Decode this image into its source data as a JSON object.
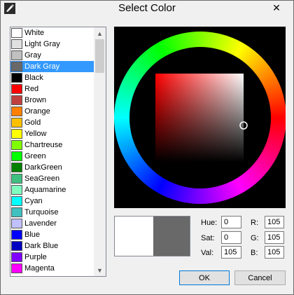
{
  "window": {
    "title": "Select Color",
    "close_glyph": "✕",
    "app_icon": "pencil-icon"
  },
  "color_list": {
    "selected_index": 3,
    "items": [
      {
        "label": "White",
        "color": "#ffffff"
      },
      {
        "label": "Light Gray",
        "color": "#e0e0e0"
      },
      {
        "label": "Gray",
        "color": "#c0c0c0"
      },
      {
        "label": "Dark Gray",
        "color": "#696969"
      },
      {
        "label": "Black",
        "color": "#000000"
      },
      {
        "label": "Red",
        "color": "#ff0000"
      },
      {
        "label": "Brown",
        "color": "#c04040"
      },
      {
        "label": "Orange",
        "color": "#ff8000"
      },
      {
        "label": "Gold",
        "color": "#ffc000"
      },
      {
        "label": "Yellow",
        "color": "#ffff00"
      },
      {
        "label": "Chartreuse",
        "color": "#80ff00"
      },
      {
        "label": "Green",
        "color": "#00ff00"
      },
      {
        "label": "DarkGreen",
        "color": "#008000"
      },
      {
        "label": "SeaGreen",
        "color": "#40c080"
      },
      {
        "label": "Aquamarine",
        "color": "#80ffc0"
      },
      {
        "label": "Cyan",
        "color": "#00ffff"
      },
      {
        "label": "Turquoise",
        "color": "#40c0c0"
      },
      {
        "label": "Lavender",
        "color": "#c0c0ff"
      },
      {
        "label": "Blue",
        "color": "#0000ff"
      },
      {
        "label": "Dark Blue",
        "color": "#0000c0"
      },
      {
        "label": "Purple",
        "color": "#8000ff"
      },
      {
        "label": "Magenta",
        "color": "#ff00ff"
      }
    ]
  },
  "fields": {
    "hue_label": "Hue:",
    "hue": "0",
    "sat_label": "Sat:",
    "sat": "0",
    "val_label": "Val:",
    "val": "105",
    "r_label": "R:",
    "r": "105",
    "g_label": "G:",
    "g": "105",
    "b_label": "B:",
    "b": "105"
  },
  "swatch": {
    "new_color": "#ffffff",
    "current_color": "#696969"
  },
  "buttons": {
    "ok": "OK",
    "cancel": "Cancel"
  }
}
